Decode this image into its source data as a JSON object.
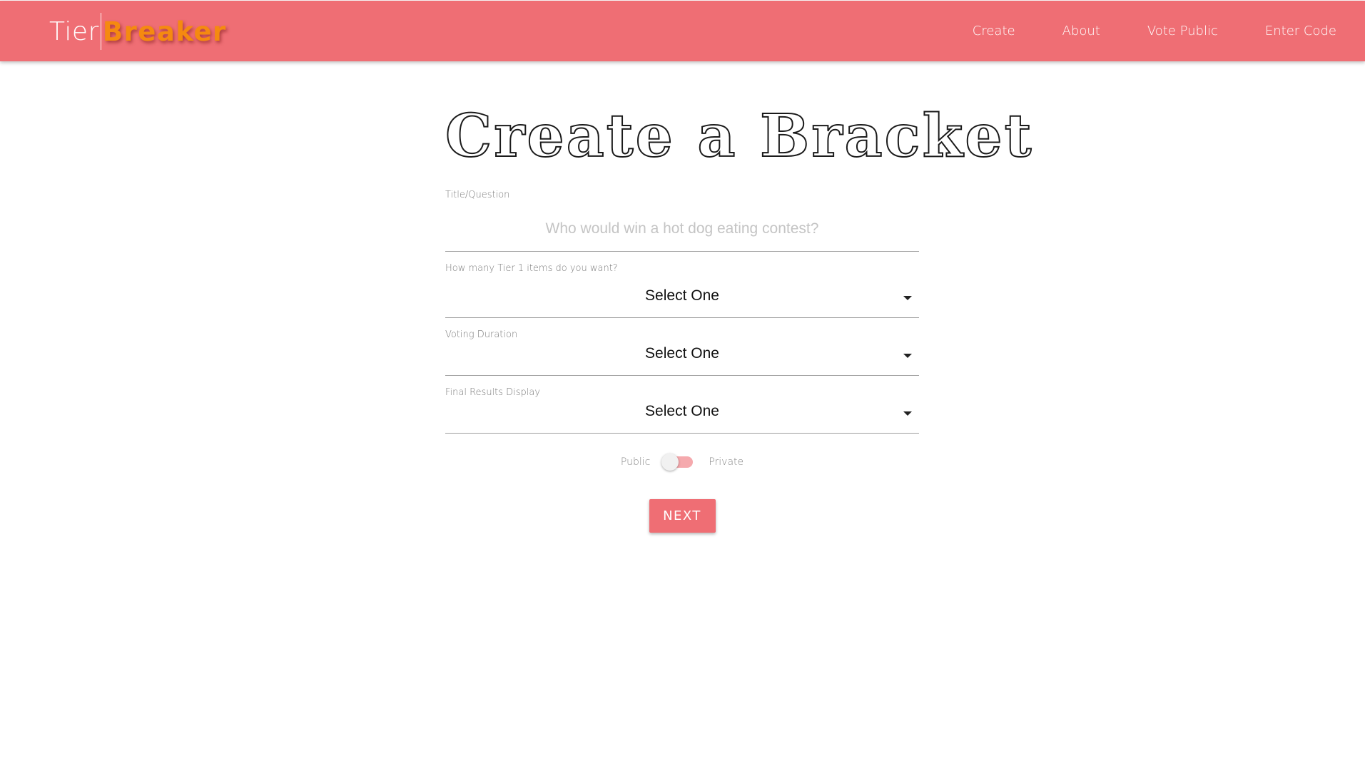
{
  "brand": {
    "tier": "Tier",
    "breaker": "Breaker"
  },
  "nav": {
    "items": [
      {
        "label": "Create"
      },
      {
        "label": "About"
      },
      {
        "label": "Vote Public"
      },
      {
        "label": "Enter Code"
      }
    ]
  },
  "page": {
    "title": "Create a Bracket"
  },
  "form": {
    "title_field": {
      "label": "Title/Question",
      "value": "",
      "placeholder": "Who would win a hot dog eating contest?"
    },
    "tier_count": {
      "label": "How many Tier 1 items do you want?",
      "selected": "Select One"
    },
    "voting_duration": {
      "label": "Voting Duration",
      "selected": "Select One"
    },
    "results_display": {
      "label": "Final Results Display",
      "selected": "Select One"
    },
    "visibility": {
      "left_label": "Public",
      "right_label": "Private",
      "is_private": false
    },
    "next_label": "NEXT"
  },
  "colors": {
    "header": "#ef6e74",
    "brand_accent": "#f58a10",
    "button": "#ef6e74",
    "switch_track": "#f5a9ad"
  },
  "icons": {
    "dropdown": "caret-down-icon"
  }
}
